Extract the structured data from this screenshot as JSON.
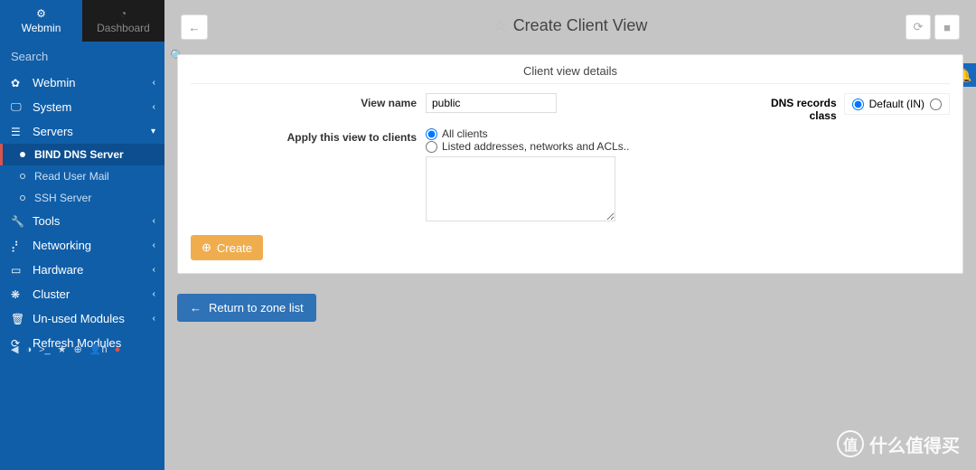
{
  "tabs": {
    "webmin": "Webmin",
    "dashboard": "Dashboard"
  },
  "search": {
    "placeholder": "Search"
  },
  "menu": {
    "webmin": "Webmin",
    "system": "System",
    "servers": "Servers",
    "tools": "Tools",
    "networking": "Networking",
    "hardware": "Hardware",
    "cluster": "Cluster",
    "unused": "Un-used Modules",
    "refresh": "Refresh Modules",
    "sub": {
      "bind": "BIND DNS Server",
      "mail": "Read User Mail",
      "ssh": "SSH Server"
    }
  },
  "toolbar_user": "n",
  "page": {
    "title": "Create Client View",
    "panel_title": "Client view details",
    "labels": {
      "view_name": "View name",
      "apply_to": "Apply this view to clients",
      "dns_class": "DNS records class"
    },
    "values": {
      "view_name": "public"
    },
    "options": {
      "all_clients": "All clients",
      "listed": "Listed addresses, networks and ACLs..",
      "default_in": "Default (IN)"
    },
    "buttons": {
      "create": "Create",
      "return": "Return to zone list"
    }
  },
  "watermark": "什么值得买"
}
